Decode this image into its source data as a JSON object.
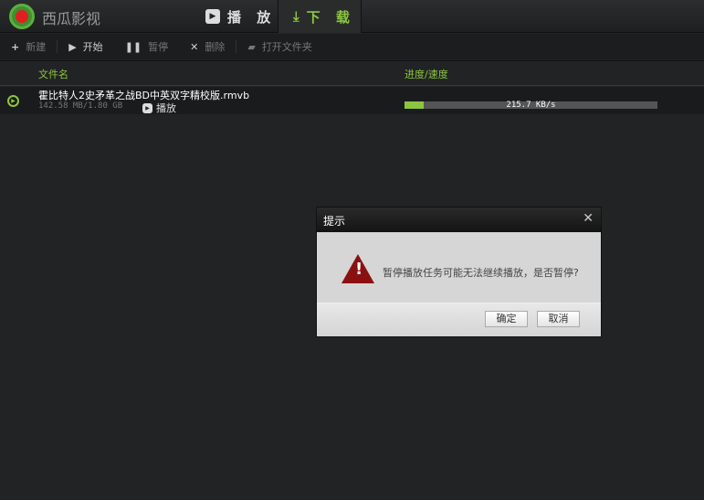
{
  "app": {
    "name": "西瓜影视"
  },
  "tabs": [
    {
      "label": "播 放",
      "icon": "play-icon"
    },
    {
      "label": "下 载",
      "icon": "download-icon",
      "active": true
    }
  ],
  "toolbar": {
    "new": "新建",
    "start": "开始",
    "pause": "暂停",
    "delete": "删除",
    "open_folder": "打开文件夹"
  },
  "columns": {
    "filename": "文件名",
    "progress": "进度/速度"
  },
  "downloads": [
    {
      "name": "霍比特人2史矛革之战BD中英双字精校版.rmvb",
      "size": "142.58 MB/1.80 GB",
      "play": "播放",
      "speed": "215.7 KB/s",
      "progress_percent": 7.7
    }
  ],
  "dialog": {
    "title": "提示",
    "message": "暂停播放任务可能无法继续播放，是否暂停?",
    "ok": "确定",
    "cancel": "取消",
    "icon": "warning-icon"
  },
  "colors": {
    "accent": "#8cc63f",
    "warning": "#8b1111"
  }
}
